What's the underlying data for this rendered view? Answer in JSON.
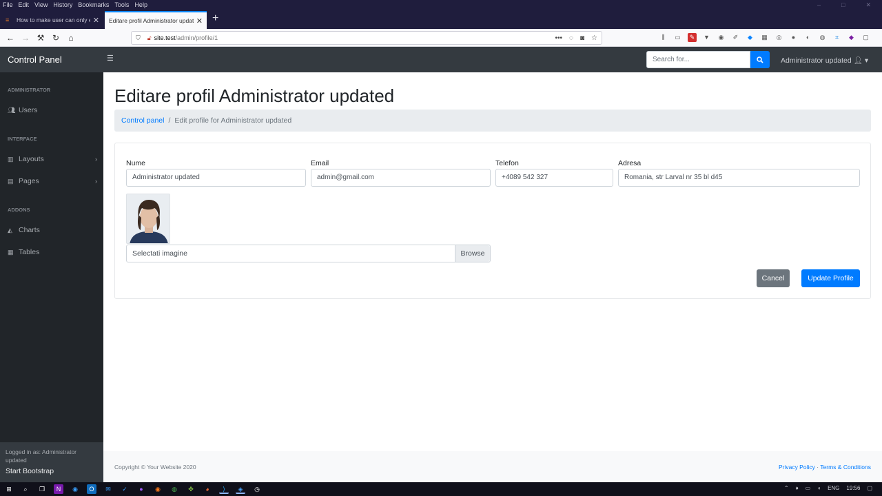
{
  "browser": {
    "menu": [
      "File",
      "Edit",
      "View",
      "History",
      "Bookmarks",
      "Tools",
      "Help"
    ],
    "tabs": [
      {
        "title": "How to make user can only edit"
      },
      {
        "title": "Editare profil Administrator updated"
      }
    ],
    "url_host": "site.test",
    "url_path": "/admin/profile/1"
  },
  "topnav": {
    "brand": "Control Panel",
    "search_placeholder": "Search for...",
    "user_label": "Administrator updated"
  },
  "sidebar": {
    "headings": [
      "ADMINISTRATOR",
      "INTERFACE",
      "ADDONS"
    ],
    "items": [
      {
        "label": "Users",
        "icon": "users-icon"
      },
      {
        "label": "Layouts",
        "icon": "columns-icon"
      },
      {
        "label": "Pages",
        "icon": "book-icon"
      },
      {
        "label": "Charts",
        "icon": "chart-area-icon"
      },
      {
        "label": "Tables",
        "icon": "table-icon"
      }
    ],
    "footer_small": "Logged in as: Administrator updated",
    "footer_name": "Start Bootstrap"
  },
  "main": {
    "title": "Editare profil Administrator updated",
    "breadcrumb": {
      "link": "Control panel",
      "current": "Edit profile for Administrator updated"
    },
    "form": {
      "name_label": "Nume",
      "name_value": "Administrator updated",
      "email_label": "Email",
      "email_value": "admin@gmail.com",
      "phone_label": "Telefon",
      "phone_value": "+4089 542 327",
      "address_label": "Adresa",
      "address_value": "Romania, str Larval nr 35 bl d45",
      "file_label": "Selectati imagine",
      "browse_label": "Browse",
      "cancel_label": "Cancel",
      "update_label": "Update Profile"
    }
  },
  "footer": {
    "copyright": "Copyright © Your Website 2020",
    "privacy": "Privacy Policy",
    "dot": "·",
    "terms": "Terms & Conditions"
  },
  "taskbar": {
    "lang": "ENG",
    "time": "19:56"
  },
  "colors": {
    "primary": "#007bff",
    "secondary": "#6c757d",
    "sidebar_bg": "#212529",
    "topnav_bg": "#343a40"
  }
}
